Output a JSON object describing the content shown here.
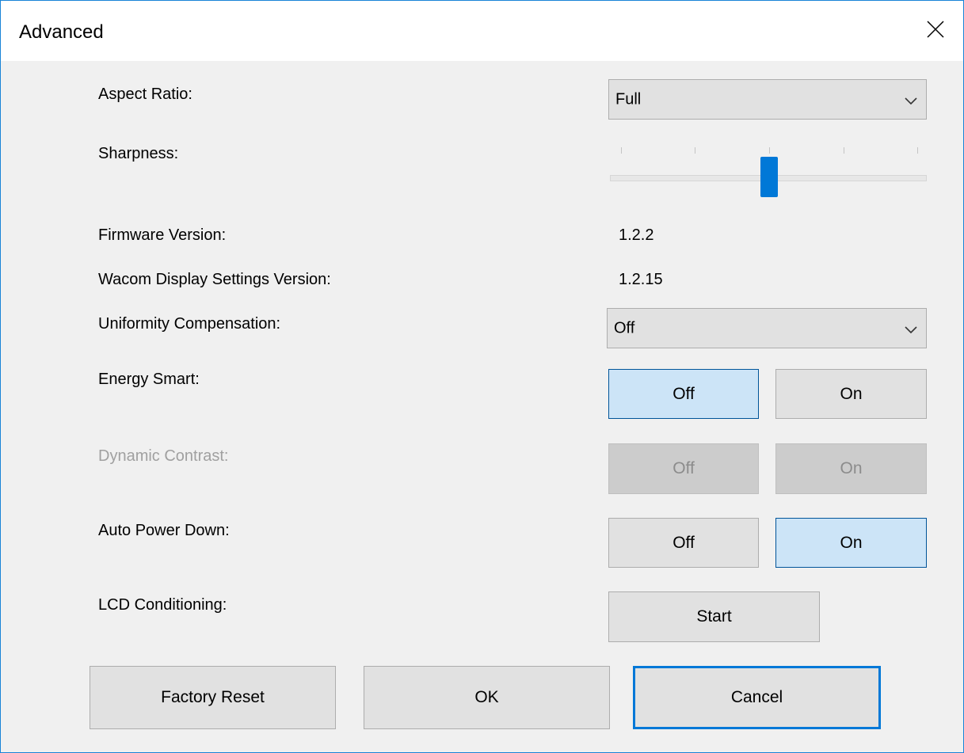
{
  "window": {
    "title": "Advanced"
  },
  "settings": {
    "aspect_ratio": {
      "label": "Aspect Ratio:",
      "value": "Full"
    },
    "sharpness": {
      "label": "Sharpness:",
      "level": 2,
      "ticks": 5,
      "max": 4
    },
    "firmware": {
      "label": "Firmware Version:",
      "value": "1.2.2"
    },
    "settings_version": {
      "label": "Wacom Display Settings Version:",
      "value": "1.2.15"
    },
    "uniformity": {
      "label": "Uniformity Compensation:",
      "value": "Off"
    },
    "energy_smart": {
      "label": "Energy Smart:",
      "off_label": "Off",
      "on_label": "On",
      "selected": "Off"
    },
    "dynamic_contrast": {
      "label": "Dynamic Contrast:",
      "off_label": "Off",
      "on_label": "On",
      "enabled": false
    },
    "auto_power_down": {
      "label": "Auto Power Down:",
      "off_label": "Off",
      "on_label": "On",
      "selected": "On"
    },
    "lcd_conditioning": {
      "label": "LCD Conditioning:",
      "button_label": "Start"
    }
  },
  "footer": {
    "factory_reset_label": "Factory Reset",
    "ok_label": "OK",
    "cancel_label": "Cancel"
  },
  "icons": {
    "close": "close-icon",
    "dropdown": "chevron-down-icon"
  },
  "colors": {
    "accent": "#0078d7",
    "selected_bg": "#cce4f7",
    "window_bg": "#f0f0f0"
  }
}
